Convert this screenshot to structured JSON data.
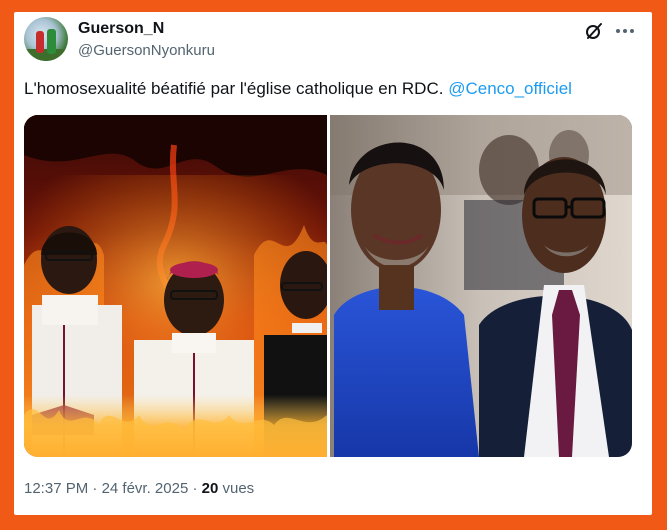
{
  "author": {
    "name": "Guerson_N",
    "handle": "@GuersonNyonkuru"
  },
  "tweet": {
    "text": "L'homosexualité béatifié par l'église catholique en RDC.",
    "mention": "@Cenco_officiel"
  },
  "meta": {
    "time": "12:37 PM",
    "separator": "·",
    "date": "24 févr. 2025",
    "views_count": "20",
    "views_label": "vues"
  },
  "icons": {
    "grok": "grok-slash-circle-icon",
    "more": "more-horizontal-icon"
  },
  "colors": {
    "frame": "#f15a16",
    "mention": "#1d9bf0",
    "secondary_text": "#536471"
  }
}
